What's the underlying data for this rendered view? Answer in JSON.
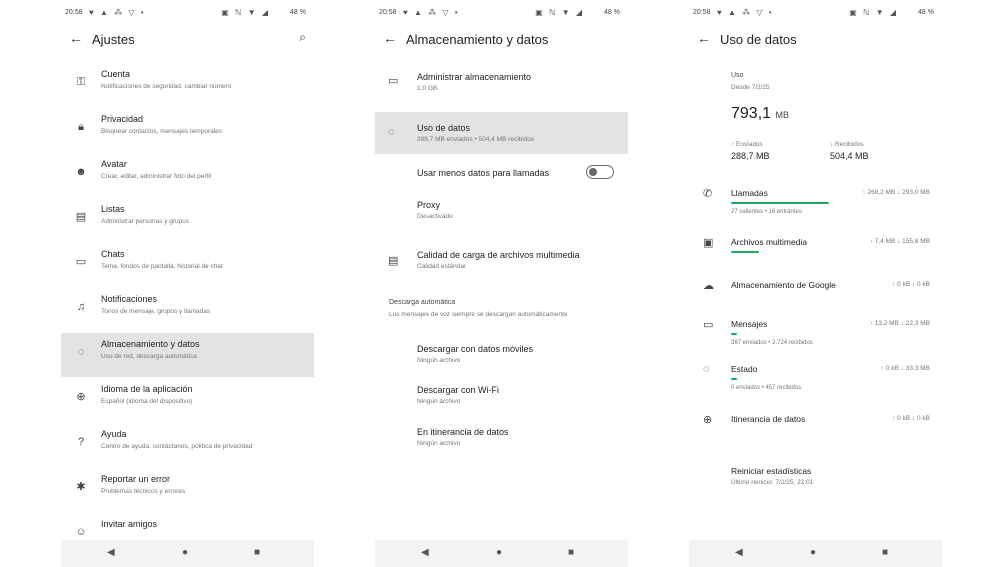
{
  "status": {
    "time": "20:58",
    "right_text": "48 %",
    "left_icons": "♥ ▲ ⁂ ▽ •",
    "right_icons": "▣ ℕ ▼ ◢"
  },
  "icons": {
    "back": "←",
    "search": "⌕",
    "nav_back": "◀",
    "nav_home": "●",
    "nav_recent": "■"
  },
  "screen1": {
    "title": "Ajustes",
    "items": [
      {
        "title": "Cuenta",
        "subtitle": "Notificaciones de seguridad, cambiar número",
        "icon": "key-icon",
        "glyph": "⚿"
      },
      {
        "title": "Privacidad",
        "subtitle": "Bloquear contactos, mensajes temporales",
        "icon": "lock-icon",
        "glyph": "🔒︎"
      },
      {
        "title": "Avatar",
        "subtitle": "Crear, editar, administrar foto del perfil",
        "icon": "avatar-icon",
        "glyph": "☻"
      },
      {
        "title": "Listas",
        "subtitle": "Administrar personas y grupos",
        "icon": "list-icon",
        "glyph": "▤"
      },
      {
        "title": "Chats",
        "subtitle": "Tema, fondos de pantalla, historial de chat",
        "icon": "chat-icon",
        "glyph": "▭"
      },
      {
        "title": "Notificaciones",
        "subtitle": "Tonos de mensaje, grupos y llamadas",
        "icon": "bell-icon",
        "glyph": "♫"
      },
      {
        "title": "Almacenamiento y datos",
        "subtitle": "Uso de red, descarga automática",
        "icon": "storage-icon",
        "glyph": "◌"
      },
      {
        "title": "Idioma de la aplicación",
        "subtitle": "Español (idioma del dispositivo)",
        "icon": "globe-icon",
        "glyph": "⊕"
      },
      {
        "title": "Ayuda",
        "subtitle": "Centro de ayuda, contáctanos, política de privacidad",
        "icon": "help-icon",
        "glyph": "?"
      },
      {
        "title": "Reportar un error",
        "subtitle": "Problemas técnicos y errores",
        "icon": "bug-icon",
        "glyph": "✱"
      },
      {
        "title": "Invitar amigos",
        "subtitle": "",
        "icon": "invite-icon",
        "glyph": "☺"
      }
    ]
  },
  "screen2": {
    "title": "Almacenamiento y datos",
    "manage": {
      "title": "Administrar almacenamiento",
      "subtitle": "1,0 GB"
    },
    "usage": {
      "title": "Uso de datos",
      "subtitle": "288,7 MB enviados • 504,4 MB recibidos"
    },
    "less_data": {
      "title": "Usar menos datos para llamadas"
    },
    "proxy": {
      "title": "Proxy",
      "subtitle": "Desactivado"
    },
    "quality": {
      "title": "Calidad de carga de archivos multimedia",
      "subtitle": "Calidad estándar"
    },
    "auto_download": {
      "head": "Descarga automática",
      "desc": "Los mensajes de voz siempre se descargan automáticamente"
    },
    "mobile": {
      "title": "Descargar con datos móviles",
      "subtitle": "Ningún archivo"
    },
    "wifi": {
      "title": "Descargar con Wi-Fi",
      "subtitle": "Ningún archivo"
    },
    "roaming": {
      "title": "En itinerancia de datos",
      "subtitle": "Ningún archivo"
    }
  },
  "screen3": {
    "title": "Uso de datos",
    "usage_label": "Uso",
    "since": "Desde 7/2/25",
    "total_value": "793,1",
    "total_unit": "MB",
    "sent_label": "↑ Enviados",
    "sent_value": "288,7 MB",
    "recv_label": "↓ Recibidos",
    "recv_value": "504,4 MB",
    "categories": [
      {
        "name": "Llamadas",
        "sent": "↑ 268,2 MB",
        "recv": "↓ 293,0 MB",
        "share": 0.7,
        "detail": "27 salientes • 16 entrantes",
        "icon": "phone-icon",
        "glyph": "✆"
      },
      {
        "name": "Archivos multimedia",
        "sent": "↑ 7,4 MB",
        "recv": "↓ 155,8 MB",
        "share": 0.2,
        "detail": "",
        "icon": "media-icon",
        "glyph": "▣"
      },
      {
        "name": "Almacenamiento de Google",
        "sent": "↑ 0 kB",
        "recv": "↓ 0 kB",
        "share": 0,
        "detail": "",
        "icon": "cloud-icon",
        "glyph": "☁"
      },
      {
        "name": "Mensajes",
        "sent": "↑ 13,2 MB",
        "recv": "↓ 22,3 MB",
        "share": 0.04,
        "detail": "387 enviados • 2.724 recibidos",
        "icon": "message-icon",
        "glyph": "▭"
      },
      {
        "name": "Estado",
        "sent": "↑ 0 kB",
        "recv": "↓ 33,3 MB",
        "share": 0.04,
        "detail": "0 enviados • 457 recibidos",
        "icon": "status-icon",
        "glyph": "◌"
      },
      {
        "name": "Itinerancia de datos",
        "sent": "↑ 0 kB",
        "recv": "↓ 0 kB",
        "share": 0,
        "detail": "",
        "icon": "roaming-icon",
        "glyph": "⊕"
      }
    ],
    "reset": {
      "title": "Reiniciar estadísticas",
      "subtitle": "Último reinicio: 7/2/25, 22:01"
    }
  },
  "colors": {
    "accent": "#1daa61",
    "highlight": "#e3e3e3"
  }
}
